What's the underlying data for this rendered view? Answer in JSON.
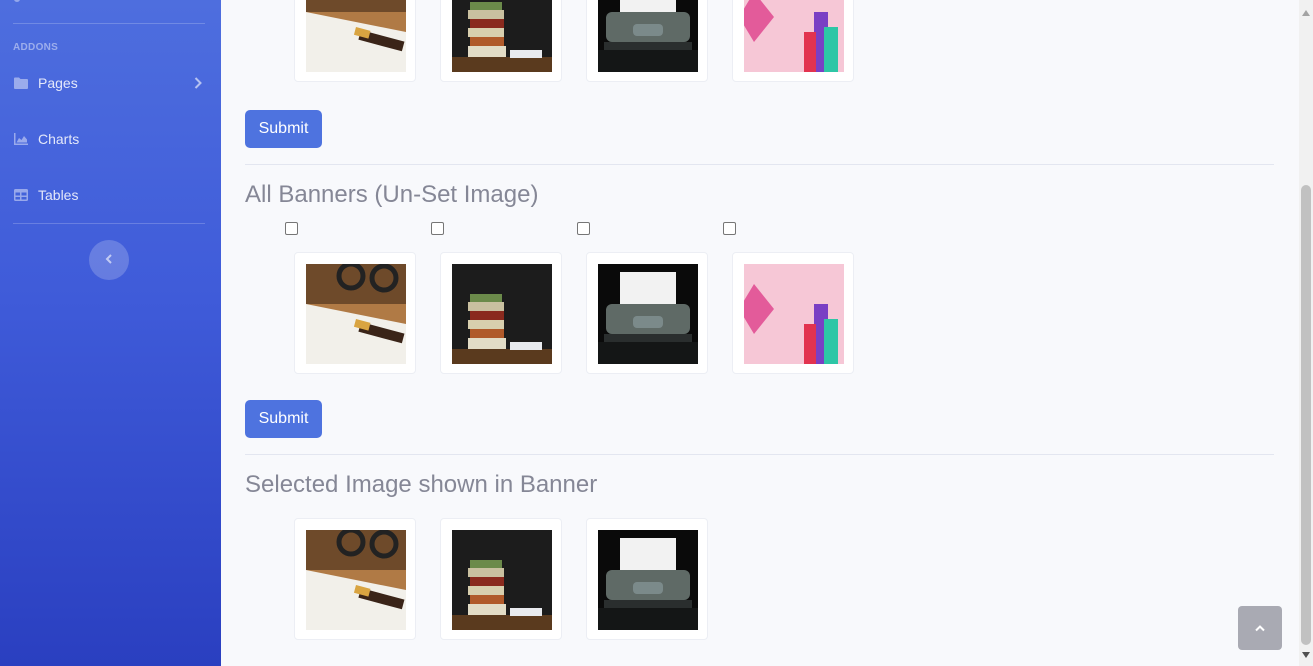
{
  "sidebar": {
    "heading": "ADDONS",
    "items": [
      {
        "label": "Pages",
        "icon": "folder-icon"
      },
      {
        "label": "Charts",
        "icon": "chart-area-icon"
      },
      {
        "label": "Tables",
        "icon": "table-icon"
      }
    ]
  },
  "sections": {
    "unset_title": "All Banners (Un-Set Image)",
    "selected_title": "Selected Image shown in Banner"
  },
  "buttons": {
    "submit_label": "Submit"
  },
  "images": [
    "notebook-glasses-pen",
    "stacked-books",
    "typewriter-elearning",
    "pink-shopping-banner"
  ],
  "colors": {
    "accent": "#4e73df",
    "sidebar_top": "#4e6ede",
    "sidebar_bottom": "#2a3fc0"
  }
}
